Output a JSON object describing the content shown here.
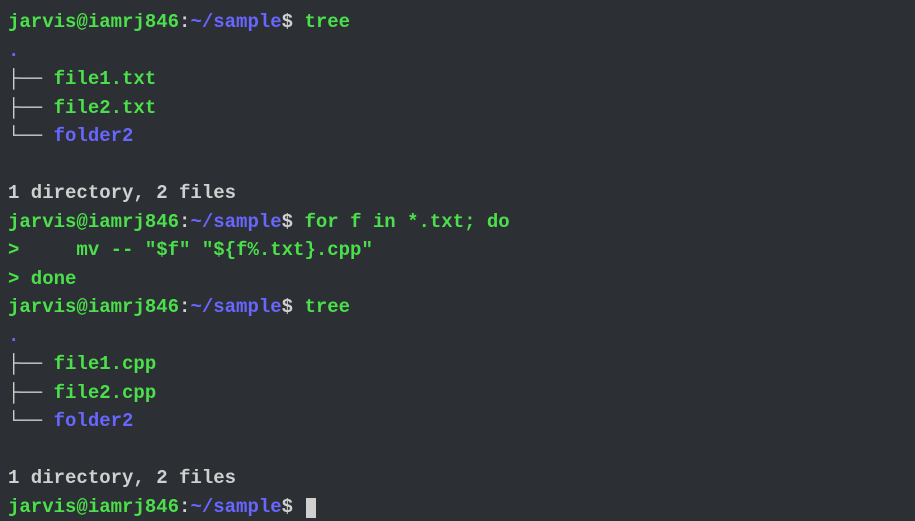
{
  "prompt": {
    "user": "jarvis@iamrj846",
    "colon": ":",
    "path": "~/sample",
    "dollar": "$"
  },
  "lines": [
    {
      "type": "prompt-cmd",
      "cmd": "tree"
    },
    {
      "type": "dot",
      "text": "."
    },
    {
      "type": "tree",
      "branch": "├── ",
      "name": "file1.txt",
      "kind": "file"
    },
    {
      "type": "tree",
      "branch": "├── ",
      "name": "file2.txt",
      "kind": "file"
    },
    {
      "type": "tree",
      "branch": "└── ",
      "name": "folder2",
      "kind": "folder"
    },
    {
      "type": "blank",
      "text": ""
    },
    {
      "type": "summary",
      "text": "1 directory, 2 files"
    },
    {
      "type": "prompt-cmd",
      "cmd": "for f in *.txt; do"
    },
    {
      "type": "ps2",
      "text": ">     mv -- \"$f\" \"${f%.txt}.cpp\""
    },
    {
      "type": "ps2",
      "text": "> done"
    },
    {
      "type": "prompt-cmd",
      "cmd": "tree"
    },
    {
      "type": "dot",
      "text": "."
    },
    {
      "type": "tree",
      "branch": "├── ",
      "name": "file1.cpp",
      "kind": "file"
    },
    {
      "type": "tree",
      "branch": "├── ",
      "name": "file2.cpp",
      "kind": "file"
    },
    {
      "type": "tree",
      "branch": "└── ",
      "name": "folder2",
      "kind": "folder"
    },
    {
      "type": "blank",
      "text": ""
    },
    {
      "type": "summary",
      "text": "1 directory, 2 files"
    },
    {
      "type": "prompt-cursor"
    }
  ]
}
